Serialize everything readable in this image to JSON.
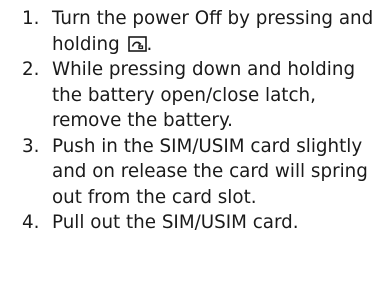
{
  "steps": [
    {
      "number": "1.",
      "text_before_icon": "Turn the power Off by pressing and holding ",
      "icon": "power-key-icon",
      "text_after_icon": "."
    },
    {
      "number": "2.",
      "text": "While pressing down and holding the battery open/close latch, remove the battery."
    },
    {
      "number": "3.",
      "text": "Push in the SIM/USIM card slightly and on release the card will spring out from the card slot."
    },
    {
      "number": "4.",
      "text": "Pull out the SIM/USIM card."
    }
  ]
}
